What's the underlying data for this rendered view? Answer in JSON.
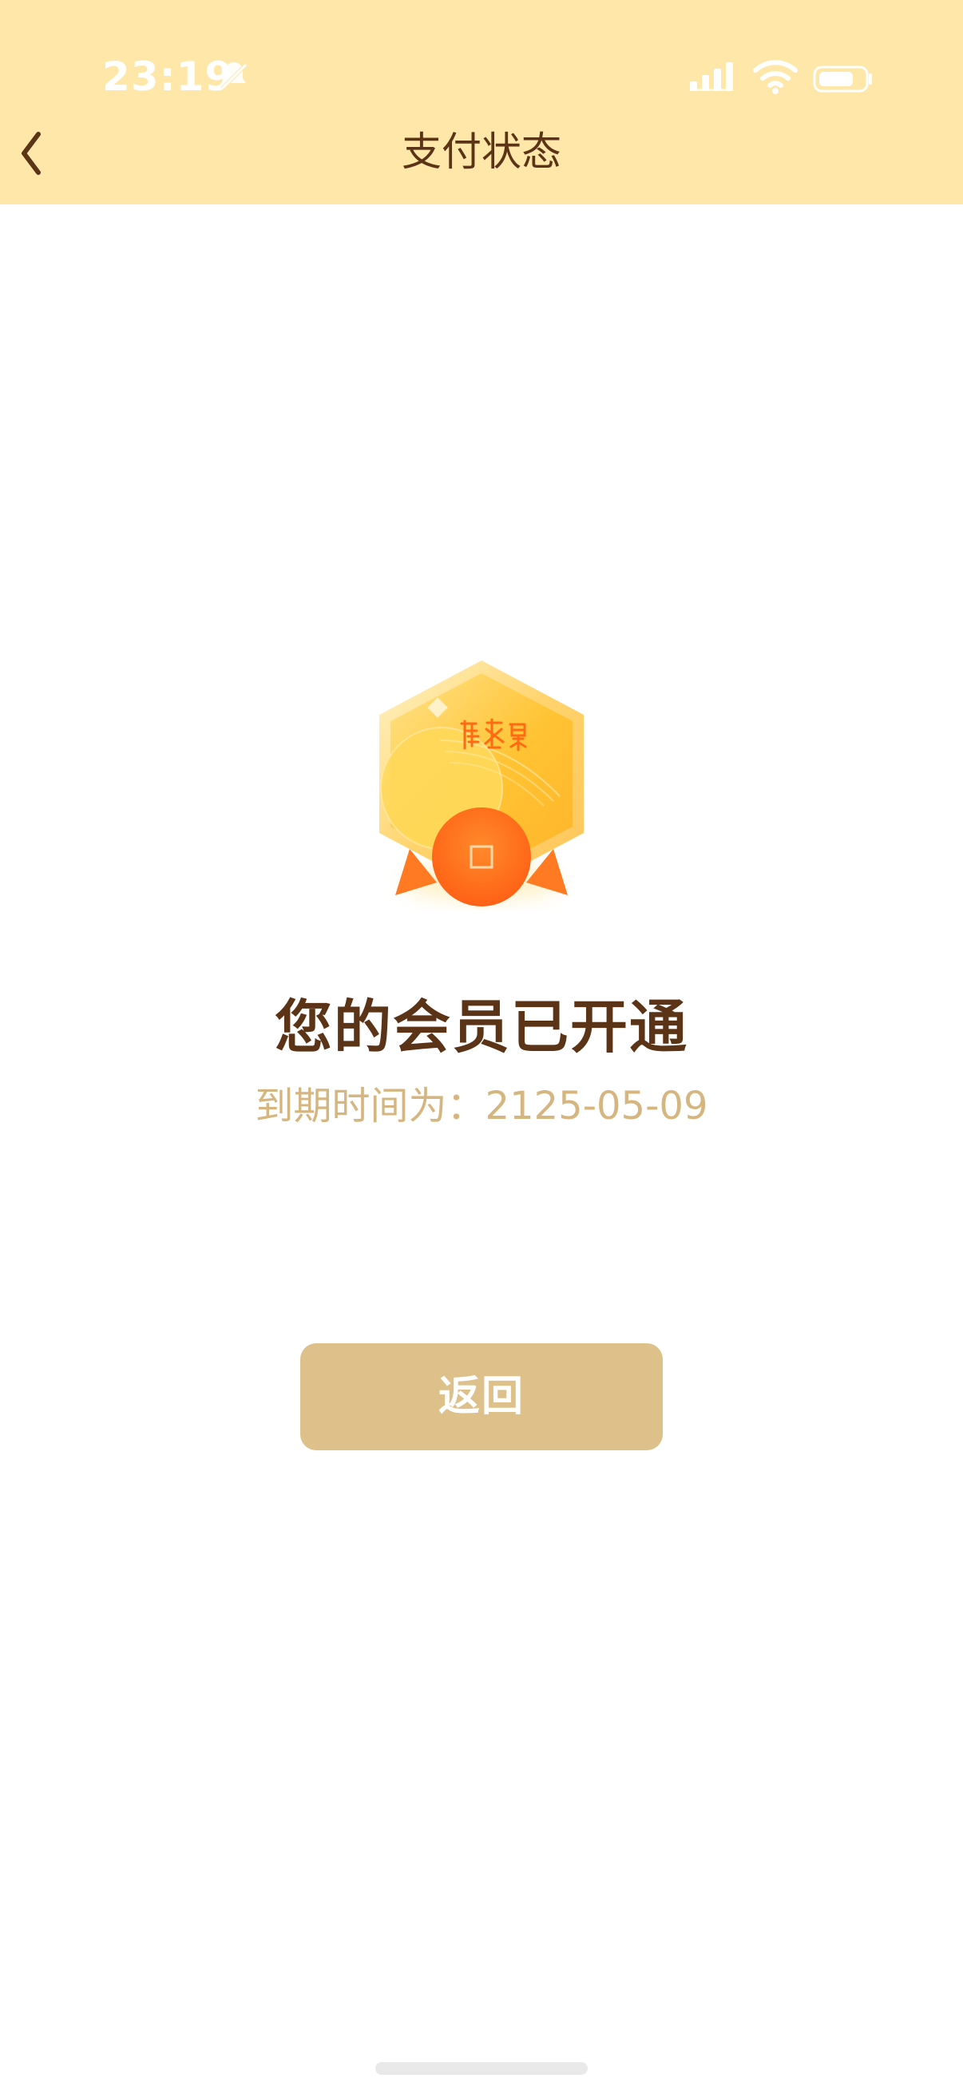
{
  "status_bar": {
    "time": "23:19"
  },
  "nav": {
    "title": "支付状态",
    "back_icon": "chevron-left-icon"
  },
  "badge": {
    "icon": "membership-medal-icon",
    "seal_text": "曆书觀",
    "colors": {
      "gold": "#FFC63D",
      "orange": "#FF6A12",
      "ribbon": "#FF7A22"
    }
  },
  "result": {
    "title": "您的会员已开通",
    "expire_label": "到期时间为：",
    "expire_date": "2125-05-09"
  },
  "actions": {
    "return_label": "返回"
  },
  "colors": {
    "header_bg": "#FFE7A9",
    "title_text": "#5B3317",
    "muted_text": "#D6B680",
    "button_bg": "#DDC08A"
  }
}
